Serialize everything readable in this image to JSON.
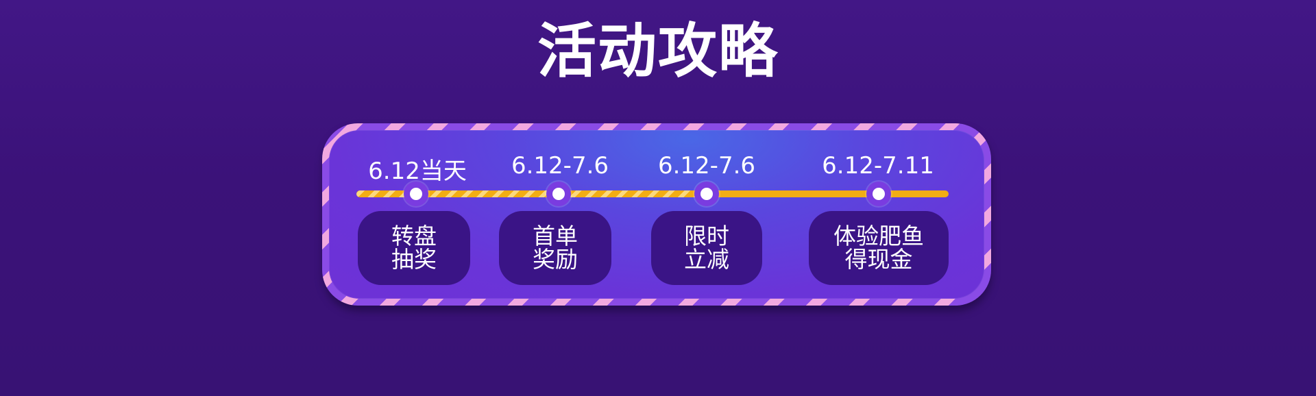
{
  "title": "活动攻略",
  "colors": {
    "background": "#3c137a",
    "panel": "#6232d8",
    "frame_stripe_light": "#f2a8e0",
    "frame_stripe_dark": "#8a4be6",
    "timeline": "#f2ad14",
    "card": "#3a1486",
    "text": "#ffffff"
  },
  "timeline": [
    {
      "date": "6.12当天",
      "line1": "转盘",
      "line2": "抽奖"
    },
    {
      "date": "6.12-7.6",
      "line1": "首单",
      "line2": "奖励"
    },
    {
      "date": "6.12-7.6",
      "line1": "限时",
      "line2": "立减"
    },
    {
      "date": "6.12-7.11",
      "line1": "体验肥鱼",
      "line2": "得现金"
    }
  ]
}
